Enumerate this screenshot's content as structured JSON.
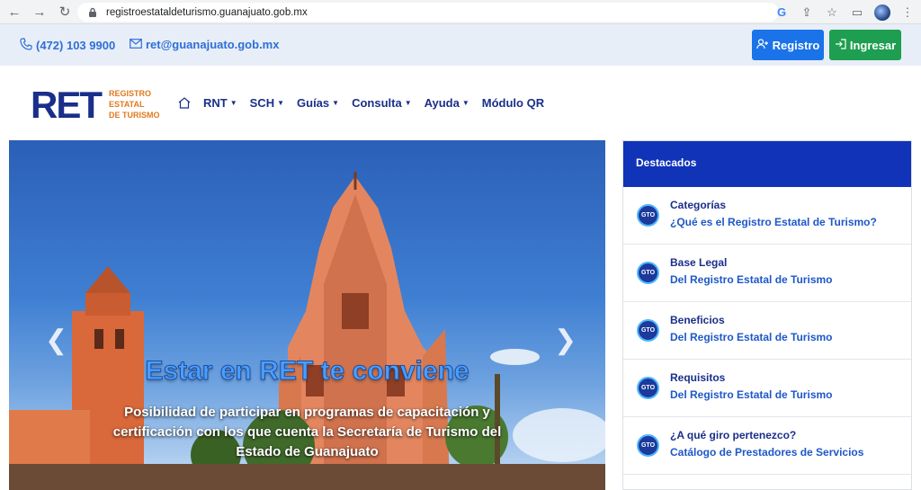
{
  "browser": {
    "url": "registroestataldeturismo.guanajuato.gob.mx"
  },
  "contact": {
    "phone": "(472) 103 9900",
    "email": "ret@guanajuato.gob.mx"
  },
  "auth": {
    "register_label": "Registro",
    "login_label": "Ingresar"
  },
  "logo": {
    "text": "RET",
    "line1": "REGISTRO",
    "line2": "ESTATAL",
    "line3": "DE TURISMO"
  },
  "nav": {
    "items": [
      {
        "label": "RNT"
      },
      {
        "label": "SCH"
      },
      {
        "label": "Guías"
      },
      {
        "label": "Consulta"
      },
      {
        "label": "Ayuda"
      },
      {
        "label": "Módulo QR"
      }
    ]
  },
  "hero": {
    "title": "Estar en RET te conviene",
    "description": "Posibilidad de participar en programas de capacitación y certificación con los que cuenta la Secretaría de Turismo del Estado de Guanajuato"
  },
  "featured": {
    "heading": "Destacados",
    "badge": "GTO",
    "items": [
      {
        "title": "Categorías",
        "subtitle": "¿Qué es el Registro Estatal de Turismo?"
      },
      {
        "title": "Base Legal",
        "subtitle": "Del Registro Estatal de Turismo"
      },
      {
        "title": "Beneficios",
        "subtitle": "Del Registro Estatal de Turismo"
      },
      {
        "title": "Requisitos",
        "subtitle": "Del Registro Estatal de Turismo"
      },
      {
        "title": "¿A qué giro pertenezco?",
        "subtitle": "Catálogo de Prestadores de Servicios"
      }
    ]
  },
  "colors": {
    "brand_blue": "#1a2f8a",
    "accent_orange": "#e07a1f",
    "register_btn": "#1a73e8",
    "login_btn": "#1e9e50",
    "panel_header": "#1033b8"
  }
}
